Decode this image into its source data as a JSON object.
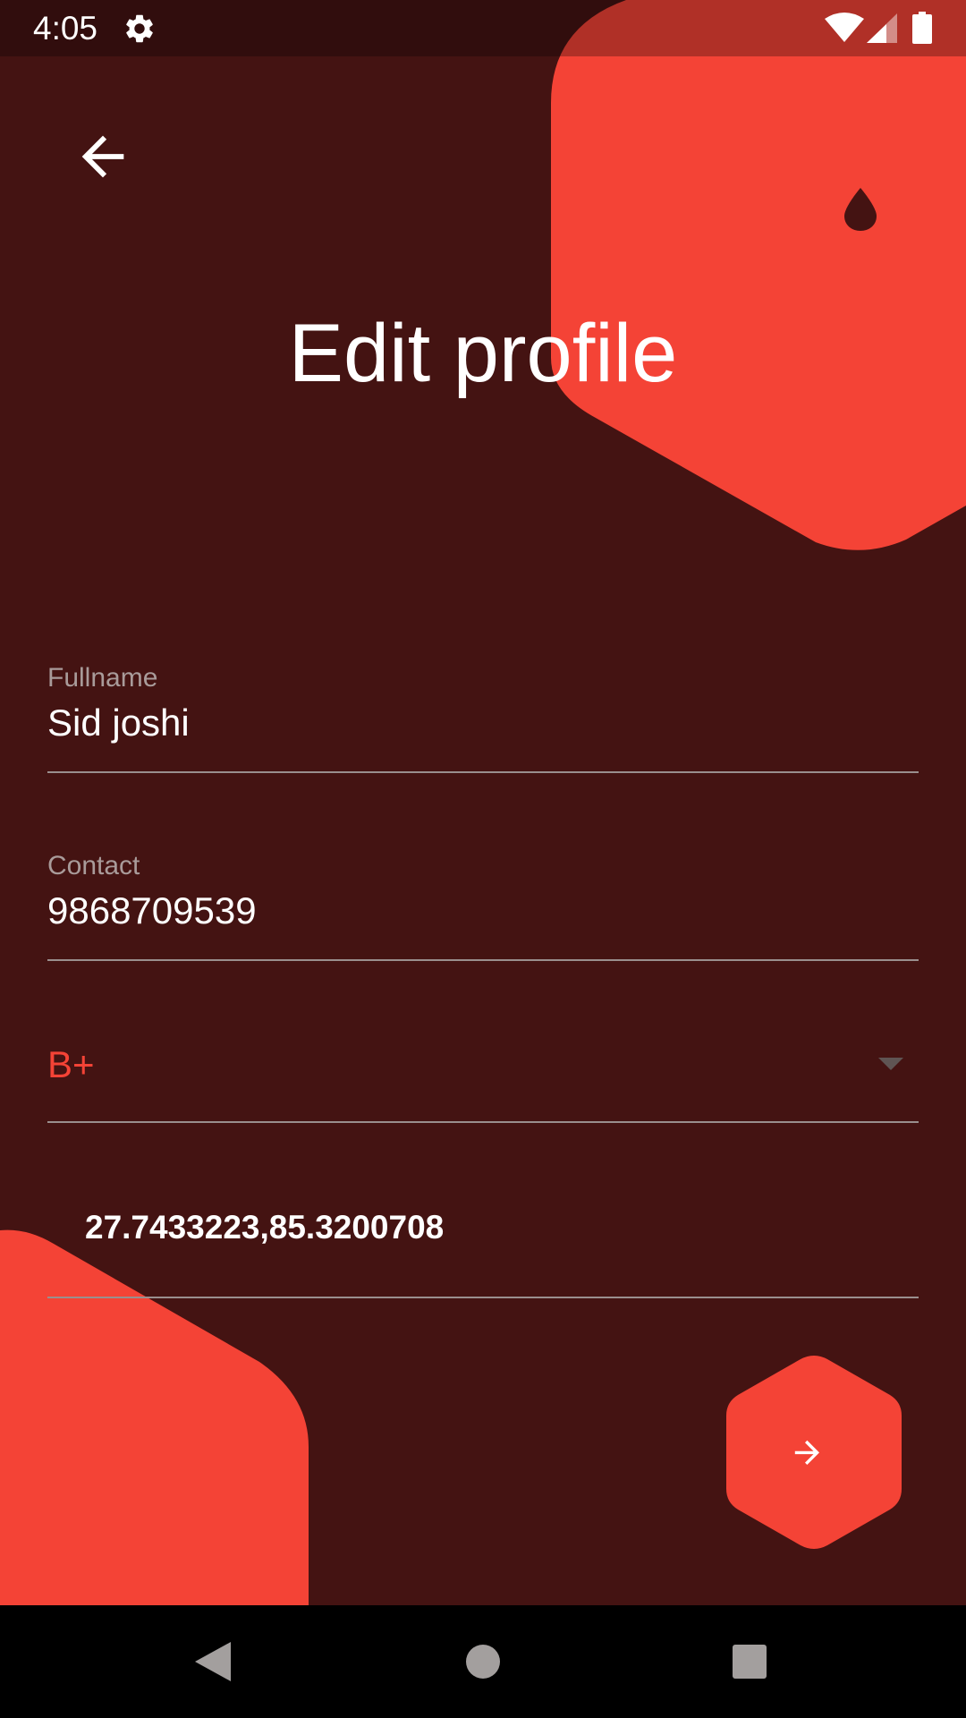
{
  "status_bar": {
    "time": "4:05",
    "icons": [
      "gear-icon",
      "wifi-icon",
      "signal-icon",
      "battery-icon"
    ]
  },
  "header": {
    "back_icon": "arrow-left-icon",
    "brand_icon": "blood-drop-icon",
    "title": "Edit profile"
  },
  "form": {
    "fullname": {
      "label": "Fullname",
      "value": "Sid joshi"
    },
    "contact": {
      "label": "Contact",
      "value": "9868709539"
    },
    "blood_group": {
      "selected": "B+"
    },
    "location": {
      "value": "27.7433223,85.3200708"
    }
  },
  "actions": {
    "next_icon": "arrow-right-icon"
  },
  "nav_bar": {
    "icons": [
      "back-triangle-icon",
      "home-circle-icon",
      "recents-square-icon"
    ]
  },
  "colors": {
    "background": "#441312",
    "accent": "#f44336",
    "text": "#ffffff",
    "label": "#a99b9a",
    "underline": "#9a8f8e"
  }
}
